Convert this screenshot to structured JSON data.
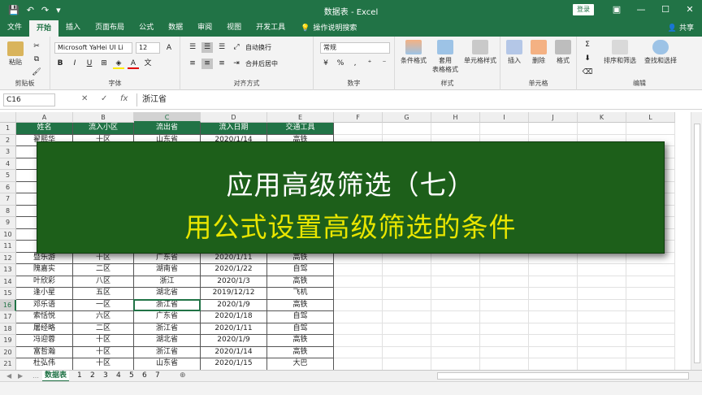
{
  "window": {
    "title": "数据表 - Excel",
    "login_label": "登录",
    "controls": [
      "▣",
      "—",
      "☐",
      "✕"
    ]
  },
  "quick_access": {
    "save": "💾",
    "undo": "↶",
    "redo": "↷",
    "more": "▾"
  },
  "tabs": [
    "文件",
    "开始",
    "插入",
    "页面布局",
    "公式",
    "数据",
    "审阅",
    "视图",
    "开发工具"
  ],
  "active_tab": "开始",
  "tell_me": "操作说明搜索",
  "share_label": "共享",
  "ribbon": {
    "clipboard": {
      "paste": "粘贴",
      "label": "剪贴板"
    },
    "font": {
      "name": "Microsoft YaHei UI Li",
      "size": "12",
      "label": "字体",
      "bold": "B",
      "italic": "I",
      "underline": "U",
      "grow": "A",
      "shrink": "A"
    },
    "alignment": {
      "wrap": "自动换行",
      "merge": "合并后居中",
      "label": "对齐方式"
    },
    "number": {
      "format": "常规",
      "label": "数字",
      "percent": "%",
      "comma": ","
    },
    "styles": {
      "conditional": "条件格式",
      "table_line1": "套用",
      "table_line2": "表格格式",
      "cell_styles": "单元格样式",
      "label": "样式"
    },
    "cells": {
      "insert": "插入",
      "delete": "删除",
      "format": "格式",
      "label": "单元格"
    },
    "editing": {
      "sum": "Σ",
      "sort": "排序和筛选",
      "find": "查找和选择",
      "label": "编辑"
    }
  },
  "formula_bar": {
    "name_box": "C16",
    "cancel": "✕",
    "enter": "✓",
    "fx": "fx",
    "value": "浙江省"
  },
  "columns": [
    "A",
    "B",
    "C",
    "D",
    "E",
    "F",
    "G",
    "H",
    "I",
    "J",
    "K",
    "L"
  ],
  "header_row": [
    "姓名",
    "流入小区",
    "流出省",
    "流入日期",
    "交通工具"
  ],
  "rows": [
    {
      "n": "2",
      "cells": [
        "翟熙华",
        "十区",
        "山东省",
        "2020/1/14",
        "高铁"
      ]
    },
    {
      "n": "3",
      "cells": [
        "周",
        "",
        "",
        "",
        ""
      ]
    },
    {
      "n": "4",
      "cells": [
        "金",
        "",
        "",
        "",
        ""
      ]
    },
    {
      "n": "5",
      "cells": [
        "倪",
        "",
        "",
        "",
        ""
      ]
    },
    {
      "n": "6",
      "cells": [
        "蒲",
        "",
        "",
        "",
        ""
      ]
    },
    {
      "n": "7",
      "cells": [
        "孙",
        "",
        "",
        "",
        ""
      ]
    },
    {
      "n": "8",
      "cells": [
        "公",
        "",
        "",
        "",
        ""
      ]
    },
    {
      "n": "9",
      "cells": [
        "黎",
        "",
        "",
        "",
        ""
      ]
    },
    {
      "n": "10",
      "cells": [
        "劳",
        "",
        "",
        "",
        ""
      ]
    },
    {
      "n": "11",
      "cells": [
        "齐",
        "",
        "",
        "",
        ""
      ]
    },
    {
      "n": "12",
      "cells": [
        "暨乐游",
        "十区",
        "广东省",
        "2020/1/11",
        "高铁"
      ]
    },
    {
      "n": "13",
      "cells": [
        "隗嘉实",
        "二区",
        "湖南省",
        "2020/1/22",
        "自驾"
      ]
    },
    {
      "n": "14",
      "cells": [
        "叶欣彩",
        "八区",
        "浙江",
        "2020/1/3",
        "高铁"
      ]
    },
    {
      "n": "15",
      "cells": [
        "逢小星",
        "五区",
        "湖北省",
        "2019/12/12",
        "飞机"
      ]
    },
    {
      "n": "16",
      "cells": [
        "邓乐语",
        "一区",
        "浙江省",
        "2020/1/9",
        "高铁"
      ]
    },
    {
      "n": "17",
      "cells": [
        "索恬悦",
        "六区",
        "广东省",
        "2020/1/18",
        "自驾"
      ]
    },
    {
      "n": "18",
      "cells": [
        "屠经略",
        "二区",
        "浙江省",
        "2020/1/11",
        "自驾"
      ]
    },
    {
      "n": "19",
      "cells": [
        "冯迎蓉",
        "十区",
        "湖北省",
        "2020/1/9",
        "高铁"
      ]
    },
    {
      "n": "20",
      "cells": [
        "富哲瀚",
        "十区",
        "浙江省",
        "2020/1/14",
        "高铁"
      ]
    },
    {
      "n": "21",
      "cells": [
        "杜弘伟",
        "十区",
        "山东省",
        "2020/1/15",
        "大巴"
      ]
    }
  ],
  "overlay": {
    "line1": "应用高级筛选（七）",
    "line2": "用公式设置高级筛选的条件"
  },
  "sheets": [
    "数据表",
    "1",
    "2",
    "3",
    "4",
    "5",
    "6",
    "7"
  ],
  "active_sheet": "数据表",
  "add_sheet": "⊕",
  "colors": {
    "excel_green": "#217346",
    "banner_bg": "#1d5f1a",
    "banner_title": "#ffffff",
    "banner_sub": "#e9e600"
  }
}
